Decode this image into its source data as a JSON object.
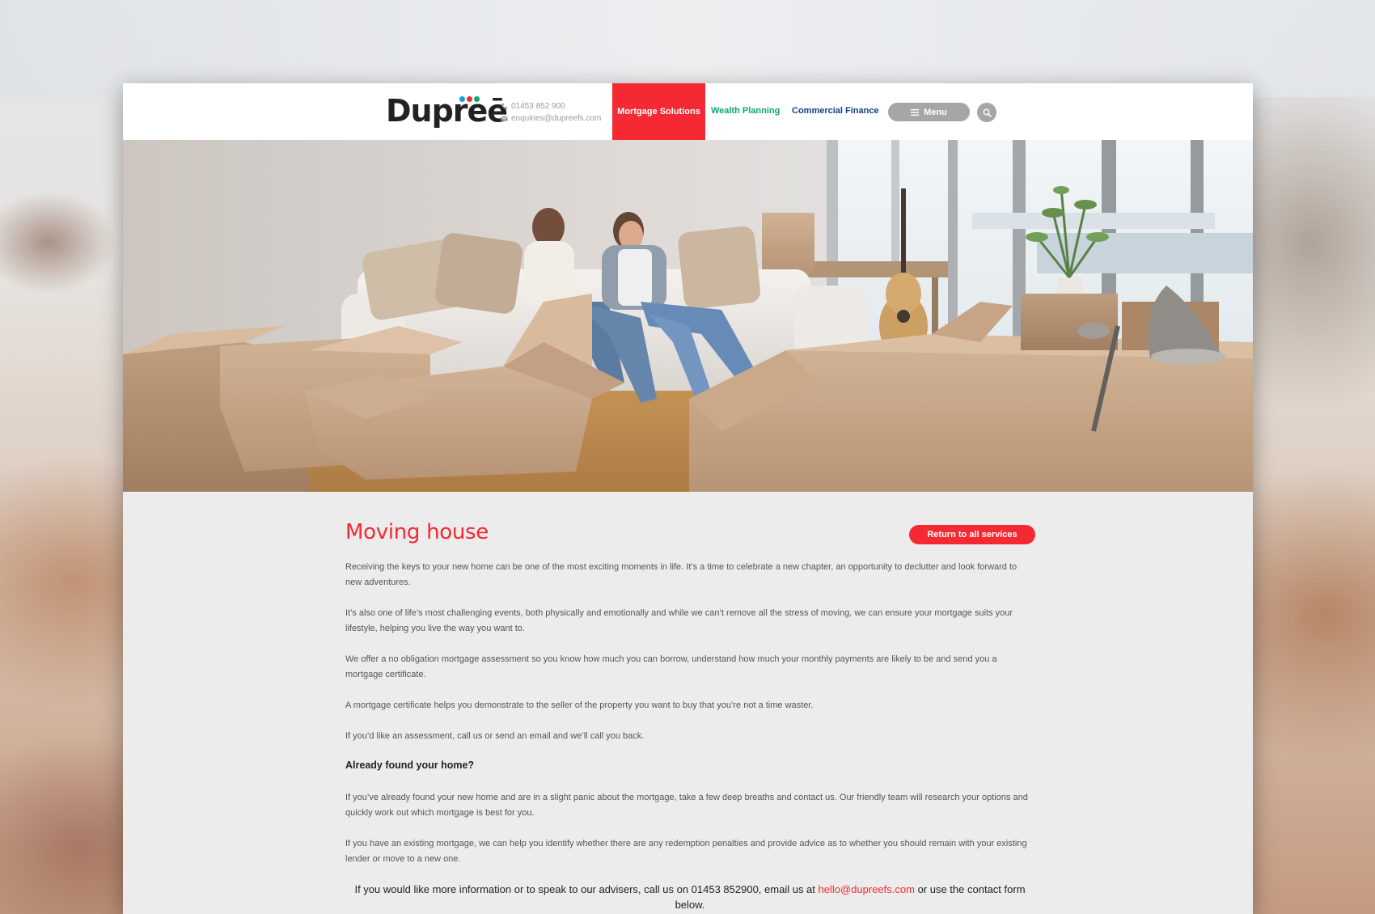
{
  "header": {
    "logo_text": "Dupreē",
    "logo_dot_colors": [
      "#1e9bd7",
      "#f52933",
      "#0aa674"
    ],
    "phone": "01453 852 900",
    "email": "enquiries@dupreefs.com",
    "nav": {
      "mortgage": "Mortgage Solutions",
      "wealth": "Wealth Planning",
      "commercial": "Commercial Finance",
      "menu": "Menu"
    }
  },
  "page": {
    "title": "Moving house",
    "return_button": "Return to all services",
    "paragraphs": [
      "Receiving the keys to your new home can be one of the most exciting moments in life. It’s a time to celebrate a new chapter, an opportunity to declutter and look forward to new adventures.",
      "It’s also one of life’s most challenging events, both physically and emotionally and while we can’t remove all the stress of moving, we can ensure your mortgage suits your lifestyle, helping you live the way you want to.",
      "We offer a no obligation mortgage assessment so you know how much you can borrow, understand how much your monthly payments are likely to be and send you a mortgage certificate.",
      "A mortgage certificate helps you demonstrate to the seller of the property you want to buy that you’re not a time waster.",
      "If you’d like an assessment, call us or send an email and we’ll call you back."
    ],
    "subheading": "Already found your home?",
    "paragraphs2": [
      "If you’ve already found your new home and are in a slight panic about the mortgage, take a few deep breaths and contact us. Our friendly team will research your options and quickly work out which mortgage is best for you.",
      "If you have an existing mortgage, we can help you identify whether there are any redemption penalties and provide advice as to whether you should remain with your existing lender or move to a new one."
    ],
    "footer": {
      "before": "If you would like more information or to speak to our advisers, call us on 01453 852900, email us at ",
      "email": "hello@dupreefs.com",
      "after": " or use the contact form below."
    }
  },
  "colors": {
    "accent_red": "#f52933",
    "wealth_green": "#0aa674",
    "commercial_blue": "#123f88",
    "menu_grey": "#a6a6a6"
  },
  "icons": {
    "phone": "phone-icon",
    "email": "envelope-icon",
    "menu": "hamburger-icon",
    "search": "search-icon"
  }
}
